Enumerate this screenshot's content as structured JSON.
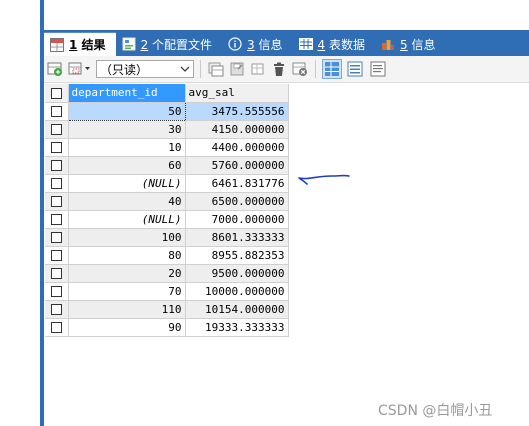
{
  "tabs": [
    {
      "num": "1",
      "label": "结果",
      "icon": "grid-result-icon",
      "active": true
    },
    {
      "num": "2",
      "label": "个配置文件",
      "icon": "profile-icon"
    },
    {
      "num": "3",
      "label": "信息",
      "icon": "info-icon"
    },
    {
      "num": "4",
      "label": "表数据",
      "icon": "table-icon"
    },
    {
      "num": "5",
      "label": "信息",
      "icon": "info-bars-icon"
    }
  ],
  "toolbar": {
    "mode_select": "（只读）"
  },
  "grid": {
    "columns": [
      "department_id",
      "avg_sal"
    ],
    "rows": [
      {
        "department_id": "50",
        "avg_sal": "3475.555556"
      },
      {
        "department_id": "30",
        "avg_sal": "4150.000000"
      },
      {
        "department_id": "10",
        "avg_sal": "4400.000000"
      },
      {
        "department_id": "60",
        "avg_sal": "5760.000000"
      },
      {
        "department_id": "(NULL)",
        "avg_sal": "6461.831776"
      },
      {
        "department_id": "40",
        "avg_sal": "6500.000000"
      },
      {
        "department_id": "(NULL)",
        "avg_sal": "7000.000000"
      },
      {
        "department_id": "100",
        "avg_sal": "8601.333333"
      },
      {
        "department_id": "80",
        "avg_sal": "8955.882353"
      },
      {
        "department_id": "20",
        "avg_sal": "9500.000000"
      },
      {
        "department_id": "70",
        "avg_sal": "10000.000000"
      },
      {
        "department_id": "110",
        "avg_sal": "10154.000000"
      },
      {
        "department_id": "90",
        "avg_sal": "19333.333333"
      }
    ]
  },
  "watermark": "CSDN @白帽小丑",
  "colors": {
    "accent": "#2f6db4",
    "header_selected": "#3399ff",
    "annotation": "#1f3dbf"
  }
}
